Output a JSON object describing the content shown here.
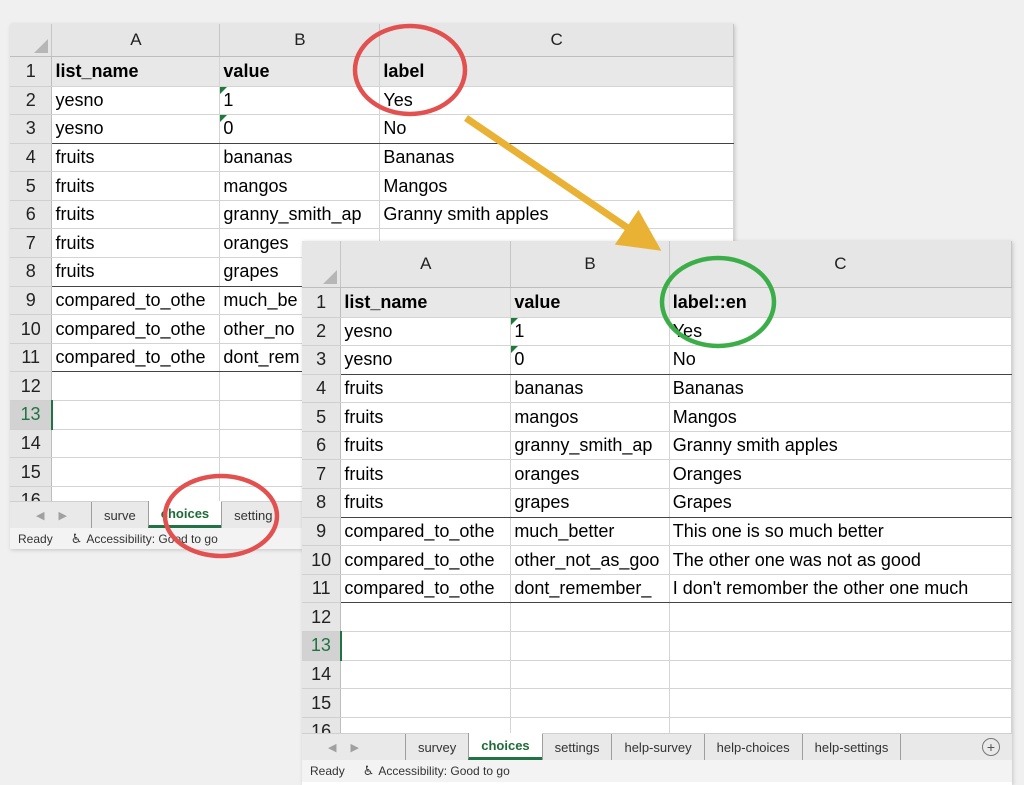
{
  "back_sheet": {
    "columns": [
      "A",
      "B",
      "C"
    ],
    "rows": [
      {
        "num": "1",
        "cells": [
          "list_name",
          "value",
          "label"
        ]
      },
      {
        "num": "2",
        "cells": [
          "yesno",
          "1",
          "Yes"
        ]
      },
      {
        "num": "3",
        "cells": [
          "yesno",
          "0",
          "No"
        ]
      },
      {
        "num": "4",
        "cells": [
          "fruits",
          "bananas",
          "Bananas"
        ]
      },
      {
        "num": "5",
        "cells": [
          "fruits",
          "mangos",
          "Mangos"
        ]
      },
      {
        "num": "6",
        "cells": [
          "fruits",
          "granny_smith_ap",
          "Granny smith apples"
        ]
      },
      {
        "num": "7",
        "cells": [
          "fruits",
          "oranges",
          ""
        ]
      },
      {
        "num": "8",
        "cells": [
          "fruits",
          "grapes",
          ""
        ]
      },
      {
        "num": "9",
        "cells": [
          "compared_to_othe",
          "much_be",
          ""
        ]
      },
      {
        "num": "10",
        "cells": [
          "compared_to_othe",
          "other_no",
          ""
        ]
      },
      {
        "num": "11",
        "cells": [
          "compared_to_othe",
          "dont_rem",
          ""
        ]
      },
      {
        "num": "12",
        "cells": [
          "",
          "",
          ""
        ]
      },
      {
        "num": "13",
        "cells": [
          "",
          "",
          ""
        ]
      },
      {
        "num": "14",
        "cells": [
          "",
          "",
          ""
        ]
      },
      {
        "num": "15",
        "cells": [
          "",
          "",
          ""
        ]
      },
      {
        "num": "16",
        "cells": [
          "",
          "",
          ""
        ]
      }
    ],
    "tabs": [
      "surve",
      "choices",
      "setting"
    ],
    "status": {
      "ready": "Ready",
      "accessibility": "Accessibility: Good to go"
    }
  },
  "front_sheet": {
    "columns": [
      "A",
      "B",
      "C"
    ],
    "rows": [
      {
        "num": "1",
        "cells": [
          "list_name",
          "value",
          "label::en"
        ]
      },
      {
        "num": "2",
        "cells": [
          "yesno",
          "1",
          "Yes"
        ]
      },
      {
        "num": "3",
        "cells": [
          "yesno",
          "0",
          "No"
        ]
      },
      {
        "num": "4",
        "cells": [
          "fruits",
          "bananas",
          "Bananas"
        ]
      },
      {
        "num": "5",
        "cells": [
          "fruits",
          "mangos",
          "Mangos"
        ]
      },
      {
        "num": "6",
        "cells": [
          "fruits",
          "granny_smith_ap",
          "Granny smith apples"
        ]
      },
      {
        "num": "7",
        "cells": [
          "fruits",
          "oranges",
          "Oranges"
        ]
      },
      {
        "num": "8",
        "cells": [
          "fruits",
          "grapes",
          "Grapes"
        ]
      },
      {
        "num": "9",
        "cells": [
          "compared_to_othe",
          "much_better",
          "This one is so much better"
        ]
      },
      {
        "num": "10",
        "cells": [
          "compared_to_othe",
          "other_not_as_goo",
          "The other one was not as good"
        ]
      },
      {
        "num": "11",
        "cells": [
          "compared_to_othe",
          "dont_remember_",
          "I don't remomber the other one much"
        ]
      },
      {
        "num": "12",
        "cells": [
          "",
          "",
          ""
        ]
      },
      {
        "num": "13",
        "cells": [
          "",
          "",
          ""
        ]
      },
      {
        "num": "14",
        "cells": [
          "",
          "",
          ""
        ]
      },
      {
        "num": "15",
        "cells": [
          "",
          "",
          ""
        ]
      },
      {
        "num": "16",
        "cells": [
          "",
          "",
          ""
        ]
      }
    ],
    "tabs": [
      "survey",
      "choices",
      "settings",
      "help-survey",
      "help-choices",
      "help-settings"
    ],
    "status": {
      "ready": "Ready",
      "accessibility": "Accessibility: Good to go"
    }
  },
  "active_tab": "choices",
  "active_row": "13",
  "icons": {
    "add_sheet": "plus-circle-icon",
    "accessibility": "accessibility-icon",
    "scroll_left": "caret-left-icon",
    "scroll_right": "caret-right-icon"
  },
  "colors": {
    "excel_green": "#217346",
    "annotation_red": "#e2504f",
    "annotation_green": "#3cae49",
    "annotation_arrow": "#eab234"
  }
}
